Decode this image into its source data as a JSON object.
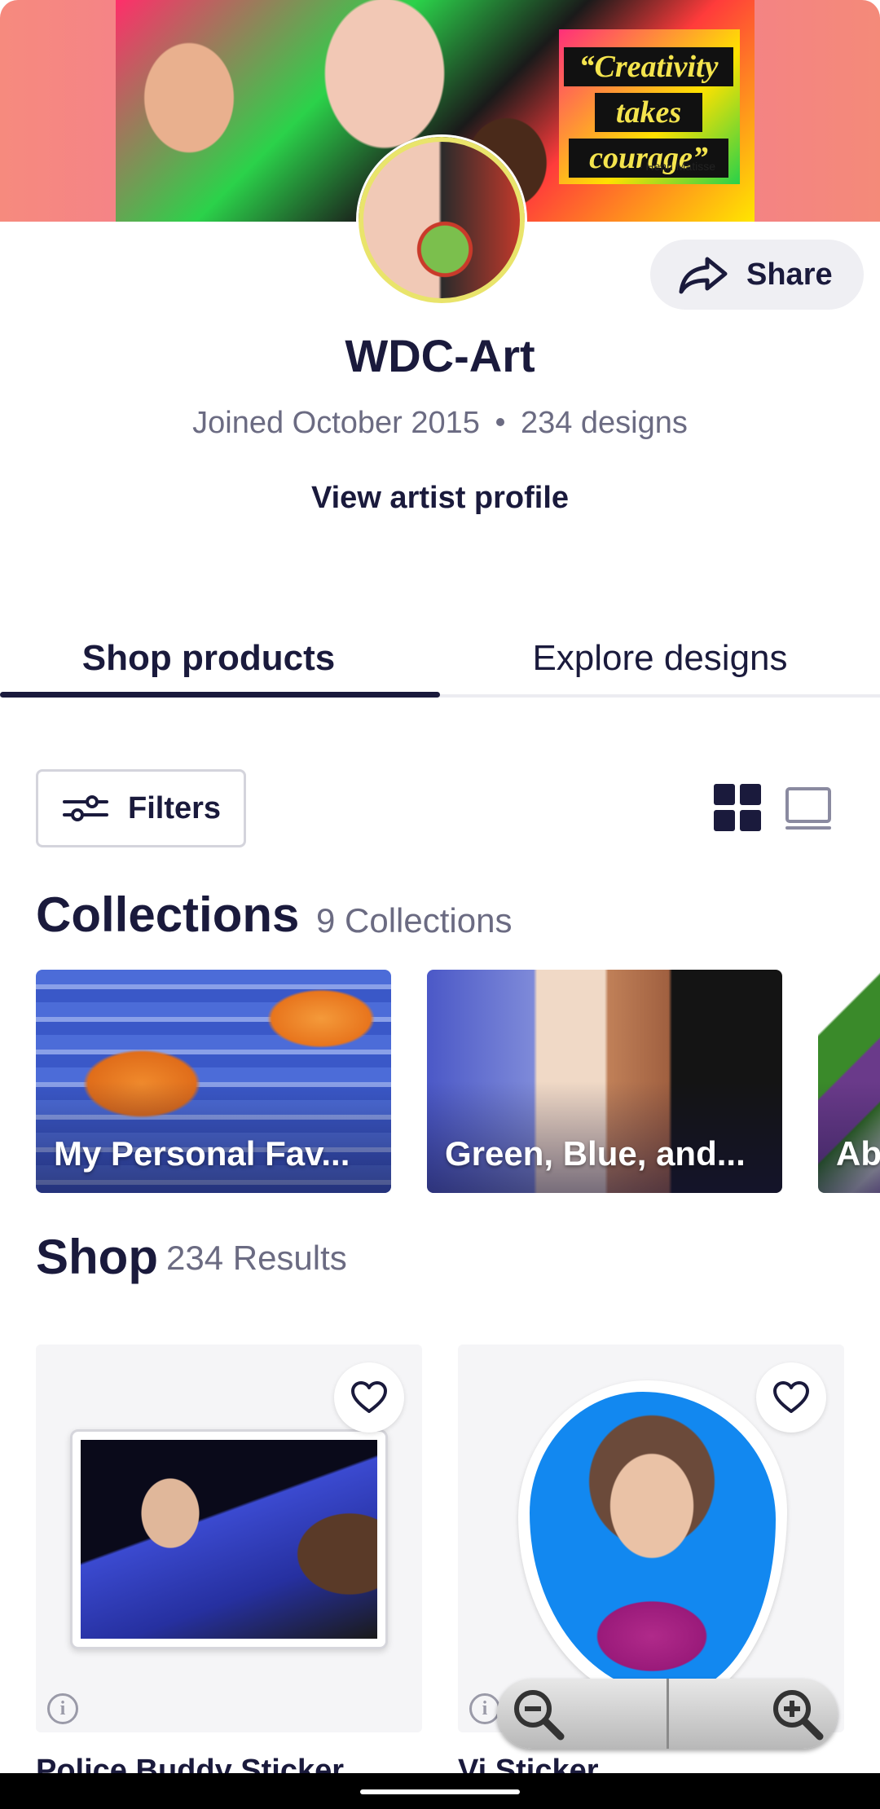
{
  "banner": {
    "quote_lines": [
      "“Creativity",
      "takes",
      "courage”"
    ],
    "quote_author": "- Henri Matisse"
  },
  "header": {
    "share_label": "Share",
    "artist_name": "WDC-Art",
    "joined": "Joined October 2015",
    "designs_count": "234 designs",
    "view_profile": "View artist profile"
  },
  "tabs": [
    {
      "label": "Shop products",
      "active": true
    },
    {
      "label": "Explore designs",
      "active": false
    }
  ],
  "toolbar": {
    "filters_label": "Filters",
    "view_modes": [
      "grid-view-icon",
      "single-view-icon"
    ],
    "active_view": "grid-view-icon"
  },
  "collections": {
    "title": "Collections",
    "count_label": "9 Collections",
    "items": [
      {
        "label": "My Personal Fav..."
      },
      {
        "label": "Green, Blue, and..."
      },
      {
        "label": "Ab"
      }
    ]
  },
  "shop": {
    "title": "Shop",
    "results_label": "234 Results",
    "products": [
      {
        "title": "Police Buddy Sticker",
        "favorited": false
      },
      {
        "title": "Vi Sticker",
        "favorited": false
      }
    ]
  },
  "colors": {
    "ink": "#1a1a3c",
    "muted": "#6b6b82",
    "banner_left": "#f68a7e",
    "banner_mid": "#f2739d"
  }
}
